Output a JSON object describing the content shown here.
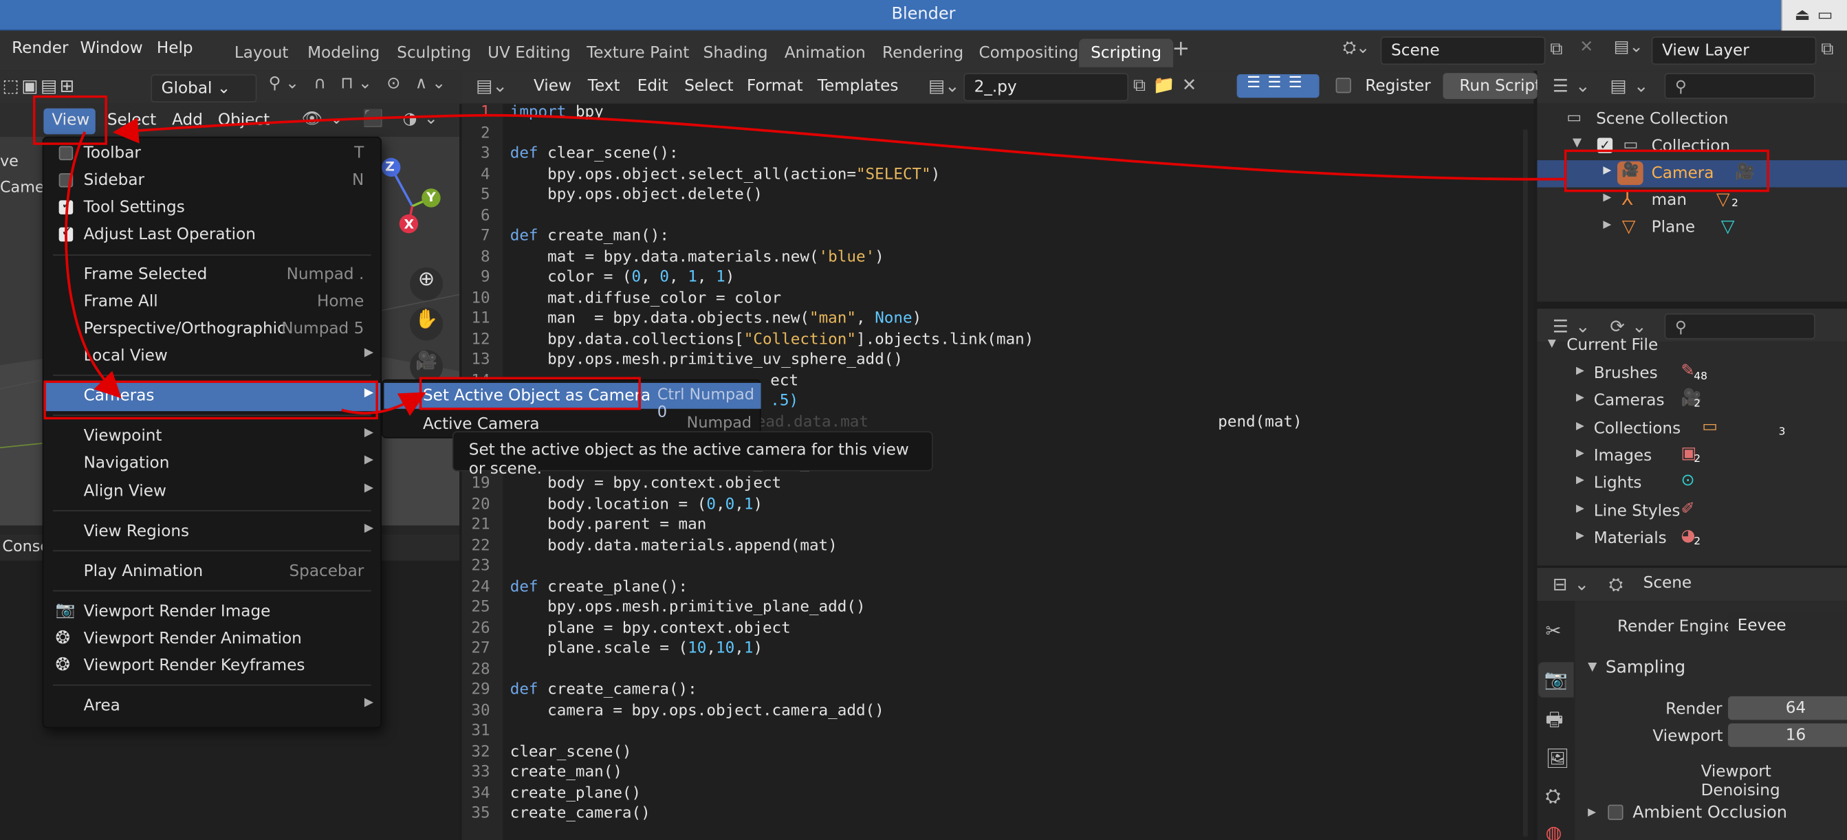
{
  "window": {
    "title": "Blender"
  },
  "topbar": {
    "menus": [
      "Render",
      "Window",
      "Help"
    ],
    "tabs": [
      "Layout",
      "Modeling",
      "Sculpting",
      "UV Editing",
      "Texture Paint",
      "Shading",
      "Animation",
      "Rendering",
      "Compositing",
      "Scripting"
    ],
    "active_tab": "Scripting",
    "scene_name": "Scene",
    "view_layer": "View Layer"
  },
  "viewport": {
    "header_items": [
      "View",
      "Select",
      "Add",
      "Object"
    ],
    "orientation": "Global",
    "left_labels": [
      "ve",
      "Came"
    ],
    "axes": [
      "Z",
      "Y",
      "X"
    ],
    "console_label": "Conso"
  },
  "view_menu": {
    "items": [
      {
        "label": "Toolbar",
        "shortcut": "T",
        "check": false
      },
      {
        "label": "Sidebar",
        "shortcut": "N",
        "check": false
      },
      {
        "label": "Tool Settings",
        "shortcut": "",
        "check": true
      },
      {
        "label": "Adjust Last Operation",
        "shortcut": "",
        "check": true
      },
      {
        "label": "Frame Selected",
        "shortcut": "Numpad ."
      },
      {
        "label": "Frame All",
        "shortcut": "Home"
      },
      {
        "label": "Perspective/Orthographic",
        "shortcut": "Numpad 5"
      },
      {
        "label": "Local View",
        "shortcut": ""
      },
      {
        "label": "Cameras",
        "shortcut": ""
      },
      {
        "label": "Viewpoint",
        "shortcut": ""
      },
      {
        "label": "Navigation",
        "shortcut": ""
      },
      {
        "label": "Align View",
        "shortcut": ""
      },
      {
        "label": "View Regions",
        "shortcut": ""
      },
      {
        "label": "Play Animation",
        "shortcut": "Spacebar"
      },
      {
        "label": "Viewport Render Image",
        "shortcut": ""
      },
      {
        "label": "Viewport Render Animation",
        "shortcut": ""
      },
      {
        "label": "Viewport Render Keyframes",
        "shortcut": ""
      },
      {
        "label": "Area",
        "shortcut": ""
      }
    ]
  },
  "cameras_submenu": {
    "items": [
      {
        "label": "Set Active Object as Camera",
        "shortcut": "Ctrl Numpad 0"
      },
      {
        "label": "Active Camera",
        "shortcut": "Numpad 0"
      }
    ],
    "tooltip": "Set the active object as the active camera for this view or scene."
  },
  "text_editor": {
    "menus": [
      "View",
      "Text",
      "Edit",
      "Select",
      "Format",
      "Templates"
    ],
    "filename": "2_.py",
    "register_label": "Register",
    "run_label": "Run Script",
    "line_numbers": [
      "1",
      "2",
      "3",
      "4",
      "5",
      "6",
      "7",
      "8",
      "9",
      "10",
      "11",
      "12",
      "13",
      "14",
      "15",
      "16",
      "17",
      "18",
      "19",
      "20",
      "21",
      "22",
      "23",
      "24",
      "25",
      "26",
      "27",
      "28",
      "29",
      "30",
      "31",
      "32",
      "33",
      "34",
      "35"
    ],
    "partial_lines": {
      "l14": "ect",
      "l15": ".5)",
      "l16": "ead.data.mat",
      "l16b": "pend(mat)"
    }
  },
  "outliner": {
    "scene_collection": "Scene Collection",
    "collection": "Collection",
    "objects": [
      {
        "name": "Camera",
        "selected": true
      },
      {
        "name": "man",
        "badge": "2"
      },
      {
        "name": "Plane"
      }
    ]
  },
  "blend_data": {
    "root": "Current File",
    "items": [
      {
        "name": "Brushes",
        "badge": "48"
      },
      {
        "name": "Cameras",
        "badge": "2"
      },
      {
        "name": "Collections",
        "badge": "3"
      },
      {
        "name": "Images",
        "badge": "2"
      },
      {
        "name": "Lights",
        "badge": ""
      },
      {
        "name": "Line Styles",
        "badge": ""
      },
      {
        "name": "Materials",
        "badge": "2"
      }
    ]
  },
  "properties": {
    "scene_label": "Scene",
    "render_engine_label": "Render Engine",
    "render_engine_value": "Eevee",
    "sampling_label": "Sampling",
    "render_label": "Render",
    "render_value": "64",
    "viewport_label": "Viewport",
    "viewport_value": "16",
    "denoise_label": "Viewport Denoising",
    "ao_label": "Ambient Occlusion"
  },
  "colors": {
    "accent": "#4772b3",
    "annotation": "#e00000"
  }
}
